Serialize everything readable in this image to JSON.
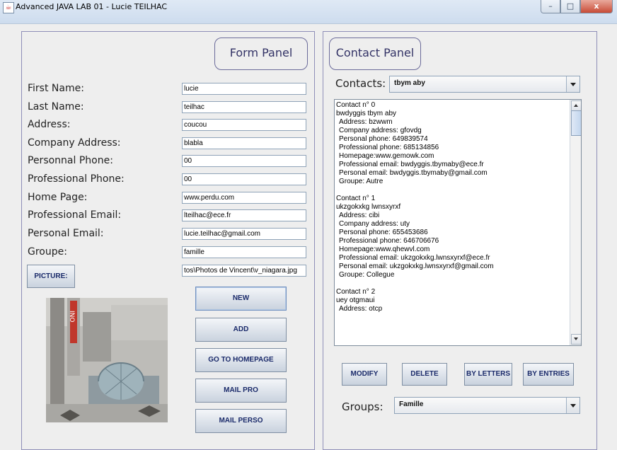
{
  "window": {
    "title": "Advanced JAVA LAB 01 - Lucie TEILHAC",
    "minimize": "–",
    "maximize": "□",
    "close": "x"
  },
  "form_panel": {
    "title": "Form Panel",
    "fields": [
      {
        "label": "First Name:",
        "value": "lucie"
      },
      {
        "label": "Last Name:",
        "value": "teilhac"
      },
      {
        "label": "Address:",
        "value": "coucou"
      },
      {
        "label": "Company Address:",
        "value": "blabla"
      },
      {
        "label": "Personnal Phone:",
        "value": "00"
      },
      {
        "label": "Professional Phone:",
        "value": "00"
      },
      {
        "label": "Home Page:",
        "value": "www.perdu.com"
      },
      {
        "label": "Professional Email:",
        "value": "lteilhac@ece.fr"
      },
      {
        "label": "Personal Email:",
        "value": "lucie.teilhac@gmail.com"
      },
      {
        "label": "Groupe:",
        "value": "famille"
      }
    ],
    "picture_button": "PICTURE:",
    "picture_path": "tos\\Photos de Vincent\\v_niagara.jpg",
    "photo_sign_text": "INO",
    "buttons": {
      "new": "NEW",
      "add": "ADD",
      "homepage": "GO TO HOMEPAGE",
      "mail_pro": "MAIL PRO",
      "mail_perso": "MAIL PERSO"
    }
  },
  "contact_panel": {
    "title": "Contact Panel",
    "contacts_label": "Contacts:",
    "contacts_selected": "tbym aby",
    "contacts": [
      {
        "lines": [
          "Contact n° 0",
          "bwdyggis tbym aby",
          " Address: bzwwm",
          " Company address: gfovdg",
          " Personal phone: 649839574",
          " Professional phone: 685134856",
          " Homepage:www.gemowk.com",
          " Professional email: bwdyggis.tbymaby@ece.fr",
          " Personal email: bwdyggis.tbymaby@gmail.com",
          " Groupe: Autre"
        ]
      },
      {
        "lines": [
          "Contact n° 1",
          "ukzgokxkg lwnsxyrxf",
          " Address: cibi",
          " Company address: uty",
          " Personal phone: 655453686",
          " Professional phone: 646706676",
          " Homepage:www.qhewvl.com",
          " Professional email: ukzgokxkg.lwnsxyrxf@ece.fr",
          " Personal email: ukzgokxkg.lwnsxyrxf@gmail.com",
          " Groupe: Collegue"
        ]
      },
      {
        "lines": [
          "Contact n° 2",
          "uey otgmaui",
          " Address: otcp"
        ]
      }
    ],
    "buttons": {
      "modify": "MODIFY",
      "delete": "DELETE",
      "by_letters": "BY LETTERS",
      "by_entries": "BY ENTRIES"
    },
    "groups_label": "Groups:",
    "groups_selected": "Famille"
  }
}
